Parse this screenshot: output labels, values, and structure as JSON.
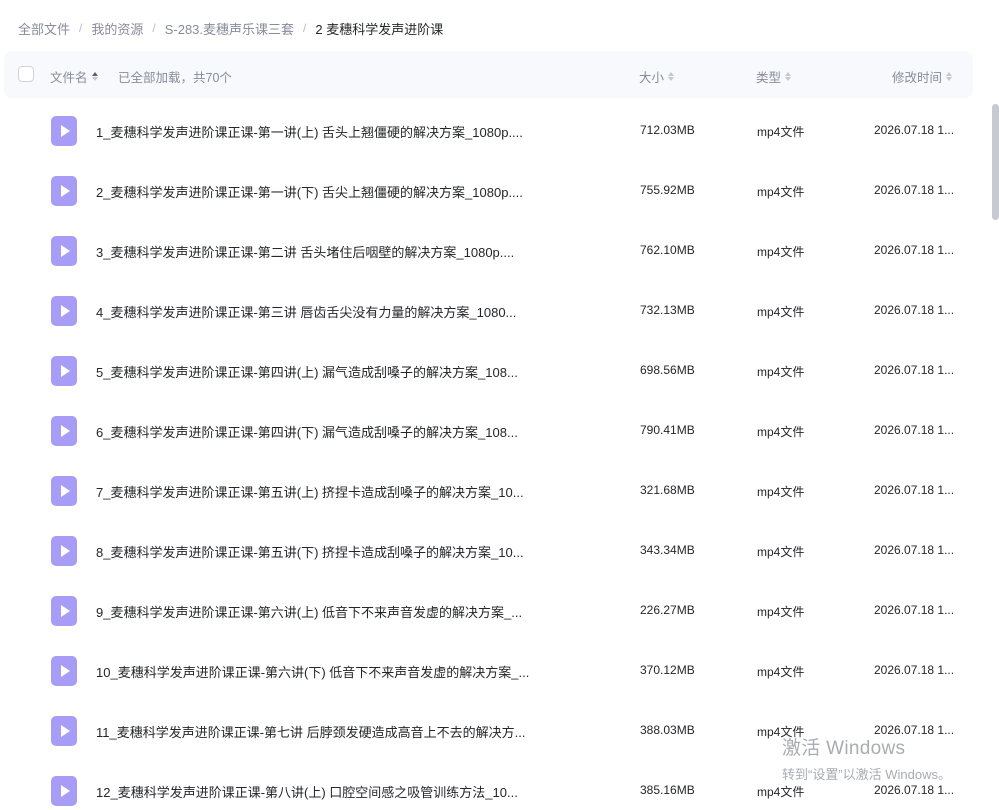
{
  "breadcrumb": {
    "items": [
      "全部文件",
      "我的资源",
      "S-283.麦穗声乐课三套",
      "2 麦穗科学发声进阶课"
    ],
    "separator": "/"
  },
  "header": {
    "name_label": "文件名",
    "count_label": "已全部加载，共70个",
    "size_label": "大小",
    "type_label": "类型",
    "time_label": "修改时间"
  },
  "files": [
    {
      "name": "1_麦穗科学发声进阶课正课-第一讲(上) 舌头上翘僵硬的解决方案_1080p....",
      "size": "712.03MB",
      "type": "mp4文件",
      "date": "2026.07.18 1..."
    },
    {
      "name": "2_麦穗科学发声进阶课正课-第一讲(下) 舌尖上翘僵硬的解决方案_1080p....",
      "size": "755.92MB",
      "type": "mp4文件",
      "date": "2026.07.18 1..."
    },
    {
      "name": "3_麦穗科学发声进阶课正课-第二讲 舌头堵住后咽壁的解决方案_1080p....",
      "size": "762.10MB",
      "type": "mp4文件",
      "date": "2026.07.18 1..."
    },
    {
      "name": "4_麦穗科学发声进阶课正课-第三讲 唇齿舌尖没有力量的解决方案_1080...",
      "size": "732.13MB",
      "type": "mp4文件",
      "date": "2026.07.18 1..."
    },
    {
      "name": "5_麦穗科学发声进阶课正课-第四讲(上) 漏气造成刮嗓子的解决方案_108...",
      "size": "698.56MB",
      "type": "mp4文件",
      "date": "2026.07.18 1..."
    },
    {
      "name": "6_麦穗科学发声进阶课正课-第四讲(下) 漏气造成刮嗓子的解决方案_108...",
      "size": "790.41MB",
      "type": "mp4文件",
      "date": "2026.07.18 1..."
    },
    {
      "name": "7_麦穗科学发声进阶课正课-第五讲(上) 挤捏卡造成刮嗓子的解决方案_10...",
      "size": "321.68MB",
      "type": "mp4文件",
      "date": "2026.07.18 1..."
    },
    {
      "name": "8_麦穗科学发声进阶课正课-第五讲(下) 挤捏卡造成刮嗓子的解决方案_10...",
      "size": "343.34MB",
      "type": "mp4文件",
      "date": "2026.07.18 1..."
    },
    {
      "name": "9_麦穗科学发声进阶课正课-第六讲(上) 低音下不来声音发虚的解决方案_...",
      "size": "226.27MB",
      "type": "mp4文件",
      "date": "2026.07.18 1..."
    },
    {
      "name": "10_麦穗科学发声进阶课正课-第六讲(下) 低音下不来声音发虚的解决方案_...",
      "size": "370.12MB",
      "type": "mp4文件",
      "date": "2026.07.18 1..."
    },
    {
      "name": "11_麦穗科学发声进阶课正课-第七讲 后脖颈发硬造成高音上不去的解决方...",
      "size": "388.03MB",
      "type": "mp4文件",
      "date": "2026.07.18 1..."
    },
    {
      "name": "12_麦穗科学发声进阶课正课-第八讲(上) 口腔空间感之吸管训练方法_10...",
      "size": "385.16MB",
      "type": "mp4文件",
      "date": "2026.07.18 1..."
    }
  ],
  "icons": {
    "file": "video-file-icon",
    "sort": "sort-icon",
    "checkbox": "checkbox"
  },
  "colors": {
    "icon_purple": "#a79df6",
    "header_bg": "#f7f9fc",
    "muted_text": "#878c9c",
    "primary_text": "#25262b"
  },
  "watermark": {
    "title": "激活 Windows",
    "subtitle": "转到“设置”以激活 Windows。"
  }
}
